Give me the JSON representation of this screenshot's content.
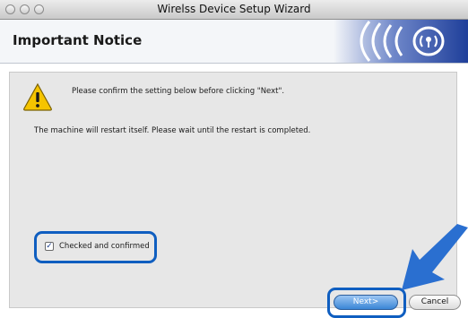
{
  "window": {
    "title": "Wirelss Device Setup Wizard"
  },
  "header": {
    "title": "Important Notice"
  },
  "notice": {
    "confirm_text": "Please confirm the setting below before clicking \"Next\".",
    "restart_text": "The machine will restart itself. Please wait until the restart is completed."
  },
  "checkbox": {
    "label": "Checked and confirmed",
    "checked": true
  },
  "buttons": {
    "next_label": "Next>",
    "cancel_label": "Cancel"
  },
  "colors": {
    "highlight": "#0f5ec0",
    "arrow": "#2a6fd0",
    "logo_blue": "#1f3f9a"
  }
}
